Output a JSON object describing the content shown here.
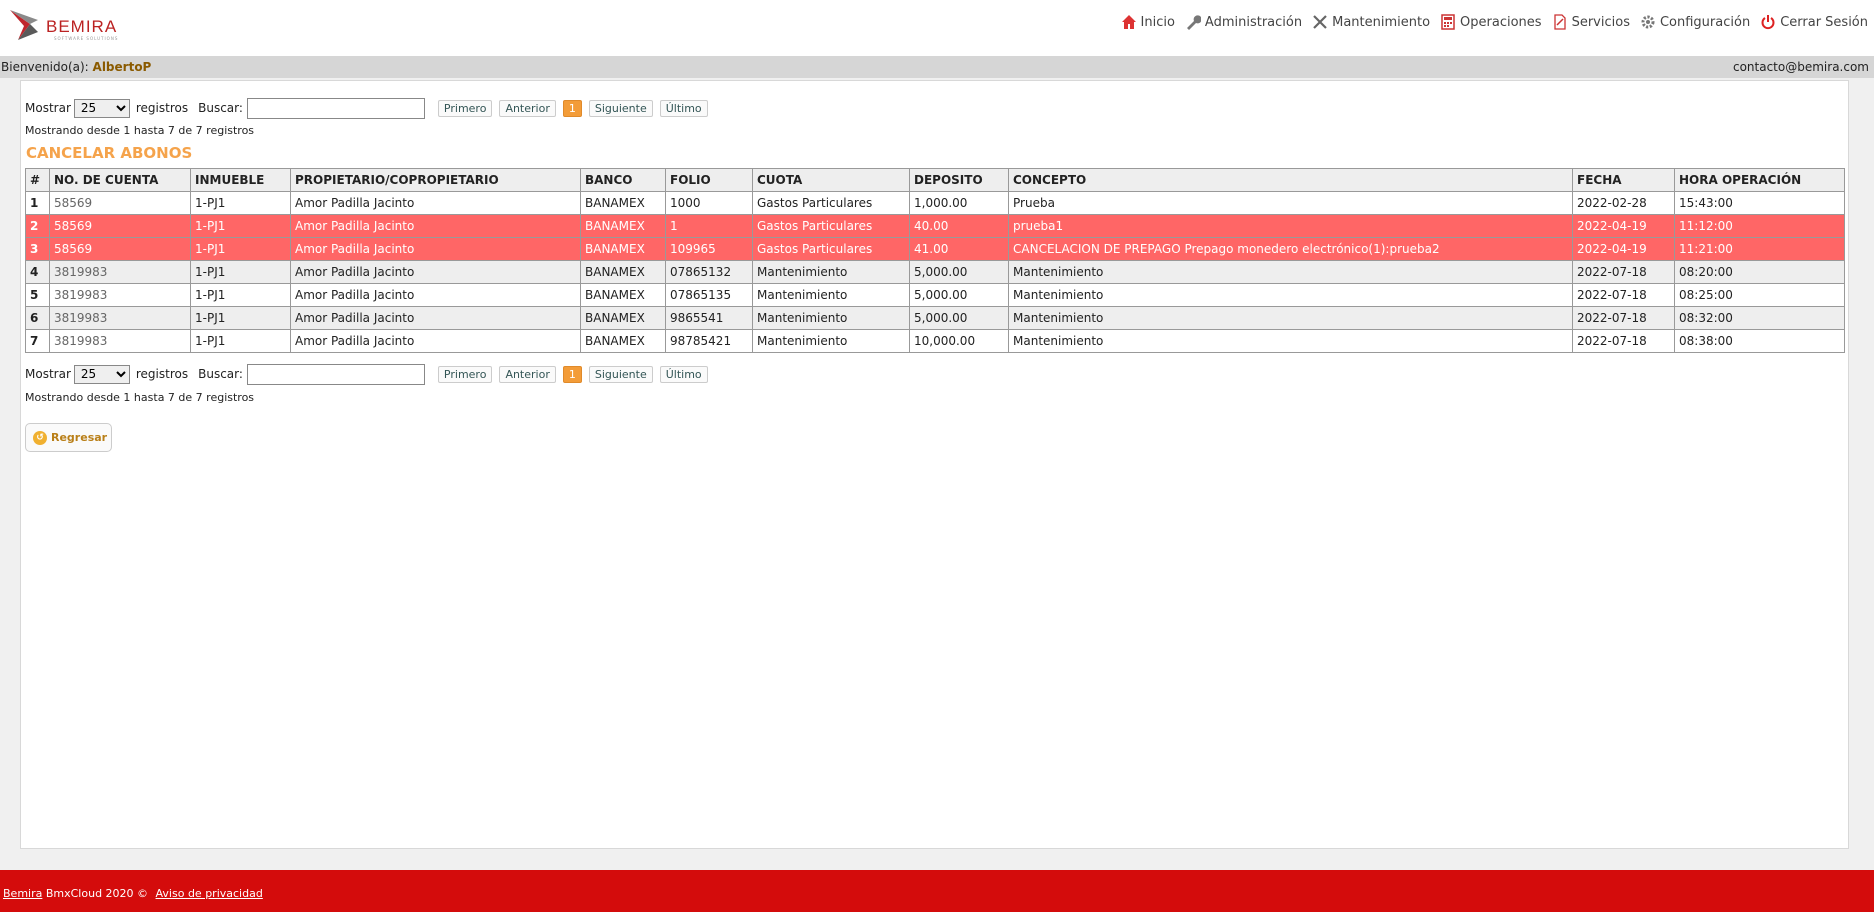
{
  "brand": {
    "name": "BEMIRA",
    "tagline": "SOFTWARE SOLUTIONS"
  },
  "nav": [
    {
      "label": "Inicio",
      "icon": "home-icon"
    },
    {
      "label": "Administración",
      "icon": "wrench-icon"
    },
    {
      "label": "Mantenimiento",
      "icon": "tools-icon"
    },
    {
      "label": "Operaciones",
      "icon": "calculator-icon"
    },
    {
      "label": "Servicios",
      "icon": "document-icon"
    },
    {
      "label": "Configuración",
      "icon": "gear-icon"
    },
    {
      "label": "Cerrar Sesión",
      "icon": "power-icon"
    }
  ],
  "welcome": {
    "prefix": "Bienvenido(a):",
    "user": "AlbertoP",
    "contact": "contacto@bemira.com"
  },
  "controls": {
    "show_label": "Mostrar",
    "show_value": "25",
    "records_label": "registros",
    "search_label": "Buscar:",
    "search_value": "",
    "pager": {
      "first": "Primero",
      "prev": "Anterior",
      "page": "1",
      "next": "Siguiente",
      "last": "Último"
    },
    "info": "Mostrando desde 1 hasta 7 de 7 registros"
  },
  "section_title": "CANCELAR ABONOS",
  "table": {
    "headers": [
      "#",
      "NO. DE CUENTA",
      "INMUEBLE",
      "PROPIETARIO/COPROPIETARIO",
      "BANCO",
      "FOLIO",
      "CUOTA",
      "DEPOSITO",
      "CONCEPTO",
      "FECHA",
      "HORA OPERACIÓN"
    ],
    "rows": [
      [
        "1",
        "58569",
        "1-PJ1",
        "Amor Padilla Jacinto",
        "BANAMEX",
        "1000",
        "Gastos Particulares",
        "1,000.00",
        "Prueba",
        "2022-02-28",
        "15:43:00"
      ],
      [
        "2",
        "58569",
        "1-PJ1",
        "Amor Padilla Jacinto",
        "BANAMEX",
        "1",
        "Gastos Particulares",
        "40.00",
        "prueba1",
        "2022-04-19",
        "11:12:00"
      ],
      [
        "3",
        "58569",
        "1-PJ1",
        "Amor Padilla Jacinto",
        "BANAMEX",
        "109965",
        "Gastos Particulares",
        "41.00",
        "CANCELACION DE PREPAGO Prepago monedero electrónico(1):prueba2",
        "2022-04-19",
        "11:21:00"
      ],
      [
        "4",
        "3819983",
        "1-PJ1",
        "Amor Padilla Jacinto",
        "BANAMEX",
        "07865132",
        "Mantenimiento",
        "5,000.00",
        "Mantenimiento",
        "2022-07-18",
        "08:20:00"
      ],
      [
        "5",
        "3819983",
        "1-PJ1",
        "Amor Padilla Jacinto",
        "BANAMEX",
        "07865135",
        "Mantenimiento",
        "5,000.00",
        "Mantenimiento",
        "2022-07-18",
        "08:25:00"
      ],
      [
        "6",
        "3819983",
        "1-PJ1",
        "Amor Padilla Jacinto",
        "BANAMEX",
        "9865541",
        "Mantenimiento",
        "5,000.00",
        "Mantenimiento",
        "2022-07-18",
        "08:32:00"
      ],
      [
        "7",
        "3819983",
        "1-PJ1",
        "Amor Padilla Jacinto",
        "BANAMEX",
        "98785421",
        "Mantenimiento",
        "10,000.00",
        "Mantenimiento",
        "2022-07-18",
        "08:38:00"
      ]
    ],
    "selected_rows": [
      1,
      2
    ]
  },
  "back_button": "Regresar",
  "footer": {
    "brand": "Bemira",
    "text": "BmxCloud 2020 ©",
    "privacy": "Aviso de privacidad"
  },
  "colors": {
    "selected_row": "#ff6666",
    "title": "#f5a34b",
    "footer": "#d40c0c",
    "page_active": "#f39c38"
  }
}
